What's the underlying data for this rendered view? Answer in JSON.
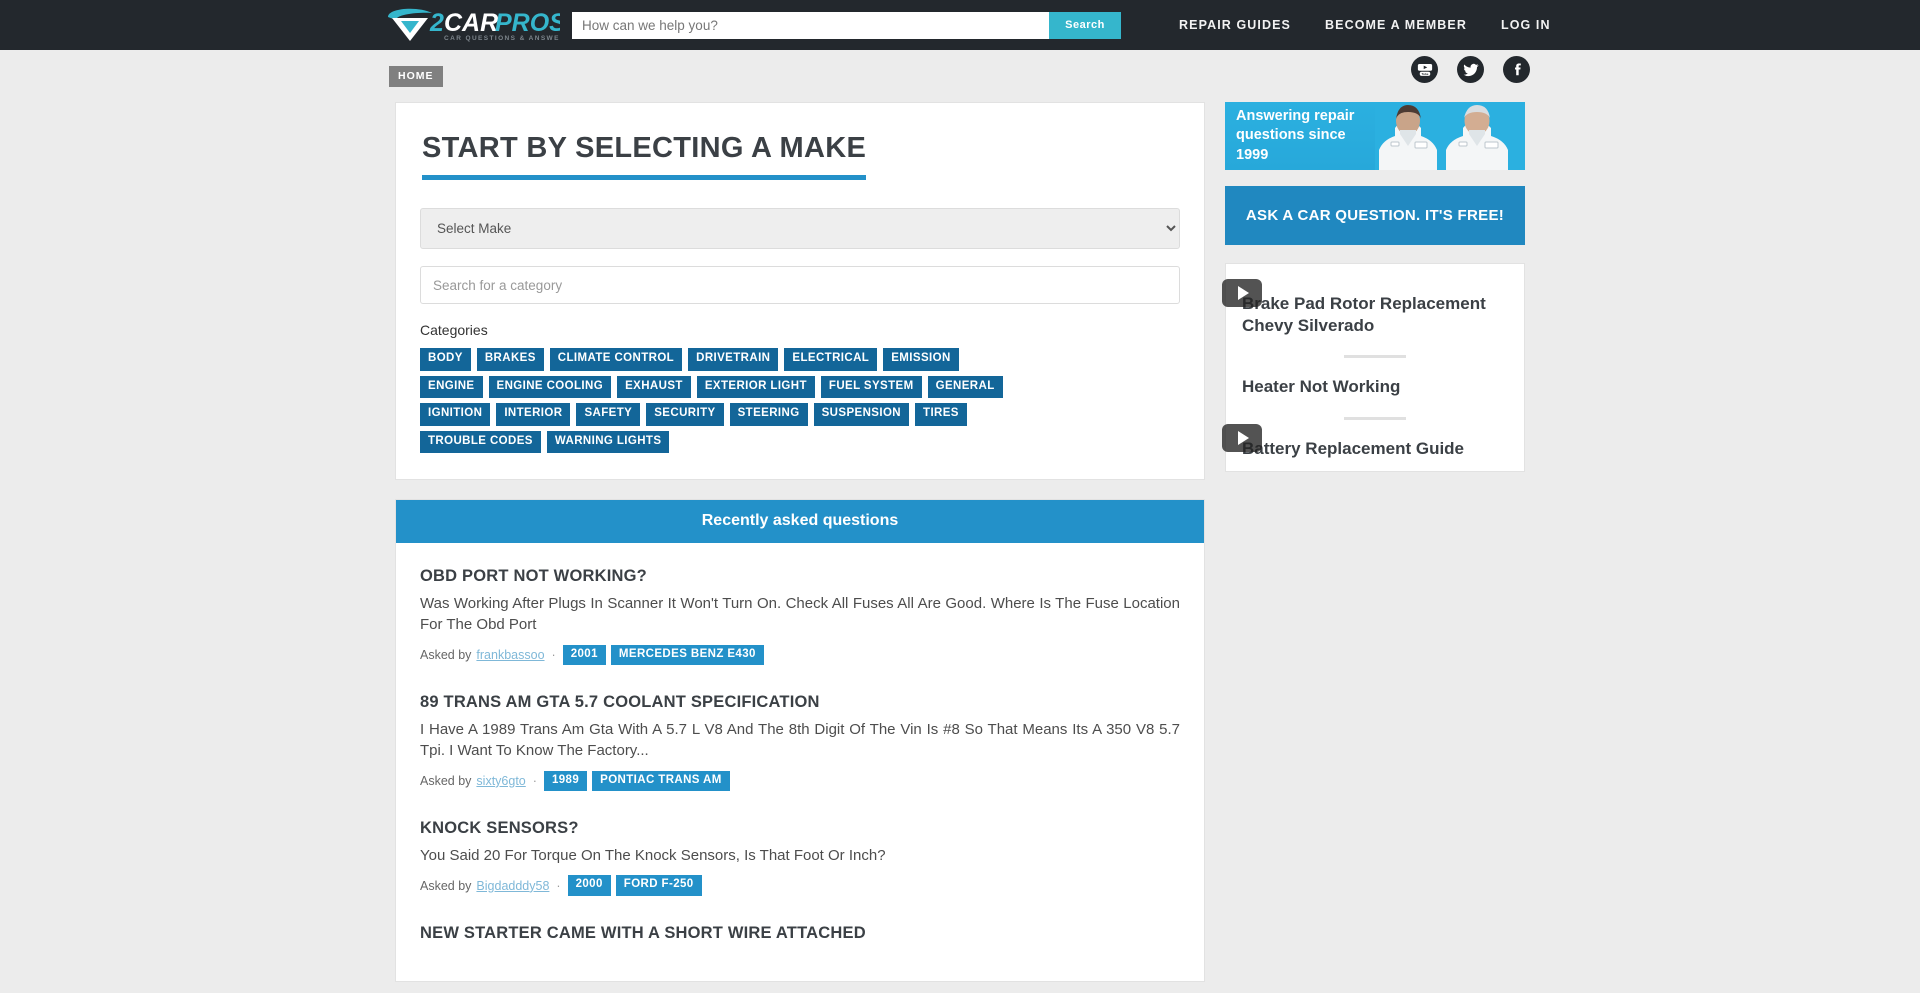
{
  "header": {
    "logo_text_1": "2",
    "logo_text_2": "CAR",
    "logo_text_3": "PROS",
    "logo_tagline": "CAR QUESTIONS & ANSWERS",
    "search_placeholder": "How can we help you?",
    "search_value": "",
    "search_button": "Search",
    "nav": [
      {
        "label": "REPAIR GUIDES"
      },
      {
        "label": "BECOME A MEMBER"
      },
      {
        "label": "LOG IN"
      }
    ],
    "socials": [
      {
        "name": "youtube",
        "label": "YouTube"
      },
      {
        "name": "twitter",
        "label": "Twitter"
      },
      {
        "name": "facebook",
        "label": "Facebook"
      }
    ]
  },
  "breadcrumb": {
    "home": "HOME"
  },
  "make_panel": {
    "title": "START BY SELECTING A MAKE",
    "select_make_value": "Select Make",
    "select_make_options": [
      "Select Make"
    ],
    "category_search_placeholder": "Search for a category",
    "category_search_value": "",
    "categories_label": "Categories",
    "categories": [
      "BODY",
      "BRAKES",
      "CLIMATE CONTROL",
      "DRIVETRAIN",
      "ELECTRICAL",
      "EMISSION",
      "ENGINE",
      "ENGINE COOLING",
      "EXHAUST",
      "EXTERIOR LIGHT",
      "FUEL SYSTEM",
      "GENERAL",
      "IGNITION",
      "INTERIOR",
      "SAFETY",
      "SECURITY",
      "STEERING",
      "SUSPENSION",
      "TIRES",
      "TROUBLE CODES",
      "WARNING LIGHTS"
    ]
  },
  "recent": {
    "heading": "Recently asked questions",
    "asked_by_label": "Asked by",
    "questions": [
      {
        "title": "OBD PORT NOT WORKING?",
        "body": "Was Working After Plugs In Scanner It Won't Turn On. Check All Fuses All Are Good. Where Is The Fuse Location For The Obd Port",
        "asker": "frankbassoo",
        "year": "2001",
        "vehicle": "MERCEDES BENZ E430"
      },
      {
        "title": "89 TRANS AM GTA 5.7 COOLANT SPECIFICATION",
        "body": "I Have A 1989 Trans Am Gta With A 5.7 L V8 And The 8th Digit Of The Vin Is #8 So That Means Its A 350 V8 5.7 Tpi. I Want To Know The Factory...",
        "asker": "sixty6gto",
        "year": "1989",
        "vehicle": "PONTIAC TRANS AM"
      },
      {
        "title": "KNOCK SENSORS?",
        "body": "You Said 20 For Torque On The Knock Sensors, Is That Foot Or Inch?",
        "asker": "Bigdadddy58",
        "year": "2000",
        "vehicle": "FORD F-250"
      },
      {
        "title": "NEW STARTER CAME WITH A SHORT WIRE ATTACHED",
        "body": "",
        "asker": "",
        "year": "",
        "vehicle": ""
      }
    ]
  },
  "sidebar": {
    "banner_text": "Answering repair questions since 1999",
    "cta_label": "ASK A CAR QUESTION. IT'S FREE!",
    "videos": [
      {
        "title": "Brake Pad Rotor Replacement Chevy Silverado",
        "has_play": true
      },
      {
        "title": "Heater Not Working",
        "has_play": false
      },
      {
        "title": "Battery Replacement Guide",
        "has_play": true
      }
    ]
  },
  "colors": {
    "topbar": "#23282d",
    "accent_teal": "#35b6cc",
    "accent_blue": "#2391c9",
    "tag_blue": "#136699",
    "cta_blue": "#2088c0",
    "page_bg": "#ececec"
  }
}
